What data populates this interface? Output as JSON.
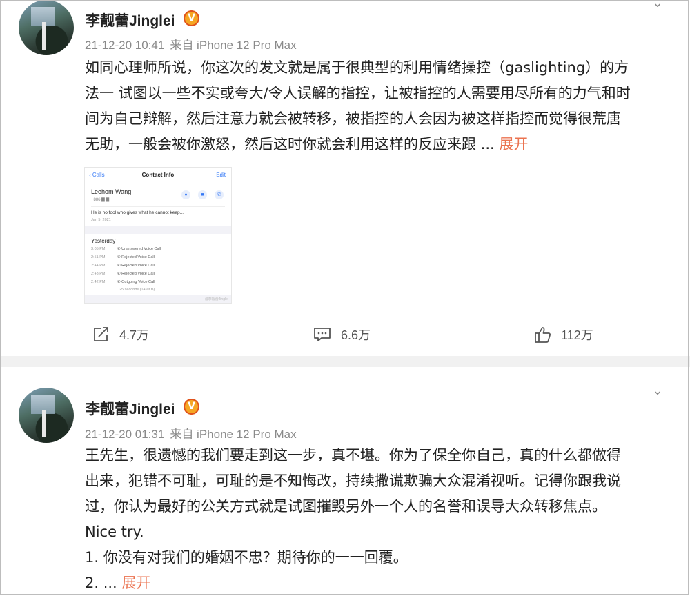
{
  "colors": {
    "link": "#eb7350",
    "meta": "#8a8a8a",
    "divider": "#f1f1f1"
  },
  "posts": [
    {
      "author": "李靓蕾Jinglei",
      "vip_badge": "V",
      "timestamp": "21-12-20 10:41",
      "source": "来自 iPhone 12 Pro Max",
      "body_lines": [
        "如同心理师所说，你这次的发文就是属于很典型的利用情绪操控（gaslighting）的方",
        "法一 试图以一些不实或夸大/令人误解的指控，让被指控的人需要用尽所有的力气和时",
        "间为自己辩解，然后注意力就会被转移，被指控的人会因为被这样指控而觉得很荒唐",
        "无助，一般会被你激怒，然后这时你就会利用这样的反应来跟 ... "
      ],
      "expand_label": "展开",
      "image": {
        "back": "Calls",
        "title": "Contact Info",
        "edit": "Edit",
        "contact_name": "Leehom Wang",
        "contact_number": "+886 ▇ ▇",
        "quote": "He is no fool who gives what he cannot keep...",
        "quote_date": "Jan 5, 2021",
        "section": "Yesterday",
        "calls": [
          {
            "time": "3:05 PM",
            "type": "Unanswered Voice Call"
          },
          {
            "time": "2:51 PM",
            "type": "Rejected Voice Call"
          },
          {
            "time": "2:44 PM",
            "type": "Rejected Voice Call"
          },
          {
            "time": "2:43 PM",
            "type": "Rejected Voice Call"
          },
          {
            "time": "2:42 PM",
            "type": "Outgoing Voice Call"
          }
        ],
        "duration": "25 seconds (149 KB)",
        "watermark": "@李靓蕾Jinglei"
      },
      "repost_count": "4.7万",
      "comment_count": "6.6万",
      "like_count": "112万"
    },
    {
      "author": "李靓蕾Jinglei",
      "vip_badge": "V",
      "timestamp": "21-12-20 01:31",
      "source": "来自 iPhone 12 Pro Max",
      "body_lines": [
        "王先生，很遗憾的我们要走到这一步，真不堪。你为了保全你自己，真的什么都做得",
        "出来，犯错不可耻，可耻的是不知悔改，持续撒谎欺骗大众混淆视听。记得你跟我说",
        "过，你认为最好的公关方式就是试图摧毁另外一个人的名誉和误导大众转移焦点。",
        "Nice try.",
        "1. 你没有对我们的婚姻不忠？期待你的一一回覆。",
        "2.  ... "
      ],
      "expand_label": "展开"
    }
  ]
}
